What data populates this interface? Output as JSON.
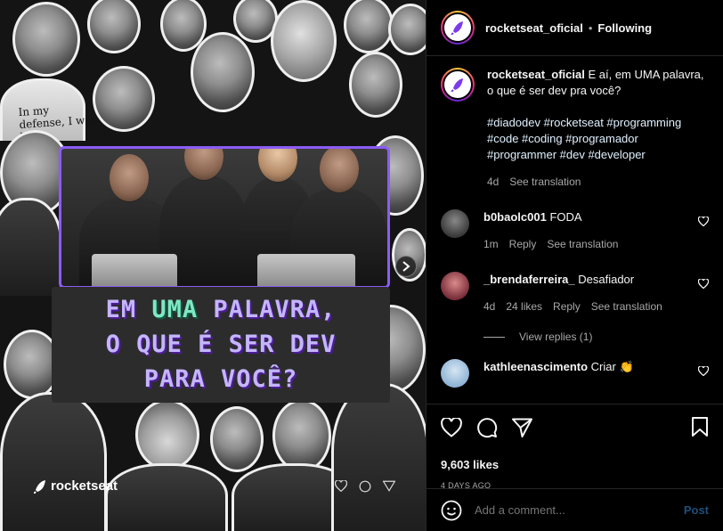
{
  "post": {
    "shirt_text": "In my defense, I was left supervised.",
    "headline": {
      "line1_pre": "EM ",
      "line1_accent": "UMA",
      "line1_post": " PALAVRA,",
      "line2": "O QUE É SER DEV",
      "line3": "PARA VOCÊ?"
    },
    "brand": "rocketseat",
    "accent_color": "#7ee8c3",
    "headline_color": "#c4b5fd",
    "frame_color": "#8b5cf6"
  },
  "header": {
    "username": "rocketseat_oficial",
    "separator": "•",
    "follow_status": "Following"
  },
  "caption": {
    "username": "rocketseat_oficial",
    "text": "E aí, em UMA palavra, o que é ser dev pra você?",
    "hashtags": "#diadodev #rocketseat #programming #code #coding #programador #programmer #dev #developer",
    "time": "4d",
    "translate": "See translation"
  },
  "comments": [
    {
      "username": "b0baolc001",
      "text": "FODA",
      "time": "1m",
      "likes": "",
      "reply": "Reply",
      "translate": "See translation",
      "avatar_color": "#3a3a3a"
    },
    {
      "username": "_brendaferreira_",
      "text": "Desafiador",
      "time": "4d",
      "likes": "24 likes",
      "reply": "Reply",
      "translate": "See translation",
      "avatar_color": "#7a2e3a"
    },
    {
      "username": "kathleenascimento",
      "text": "Criar 👏",
      "avatar_color": "#8fb4d6"
    }
  ],
  "view_replies": "View replies (1)",
  "actions": {
    "likes": "9,603 likes",
    "date": "4 DAYS AGO"
  },
  "add_comment": {
    "placeholder": "Add a comment...",
    "post_label": "Post"
  }
}
